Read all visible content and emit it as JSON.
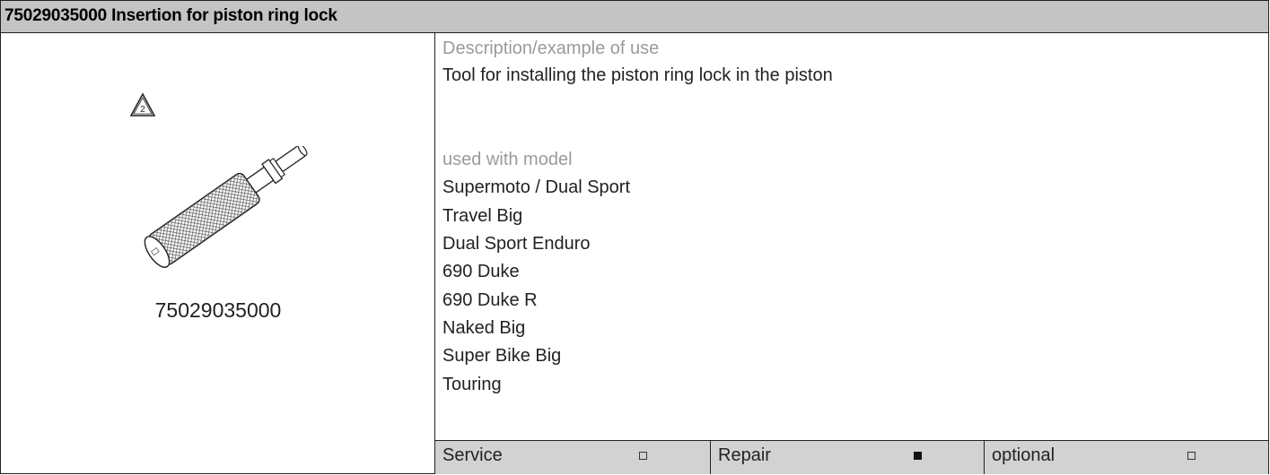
{
  "header": {
    "title": "75029035000 Insertion for piston ring lock"
  },
  "left": {
    "warning_icon": "warning-triangle-2-icon",
    "warning_number": "2",
    "image_name": "knurled-insertion-tool",
    "part_number": "75029035000"
  },
  "right": {
    "desc_label": "Description/example of use",
    "desc_text": "Tool for installing the piston ring lock in the piston",
    "models_label": "used with model",
    "models": [
      "Supermoto / Dual Sport",
      "Travel Big",
      "Dual Sport Enduro",
      "690 Duke",
      "690 Duke R",
      "Naked Big",
      "Super Bike Big",
      "Touring"
    ]
  },
  "footer": {
    "cells": [
      {
        "label": "Service",
        "checked": false
      },
      {
        "label": "Repair",
        "checked": true
      },
      {
        "label": "optional",
        "checked": false
      }
    ]
  }
}
